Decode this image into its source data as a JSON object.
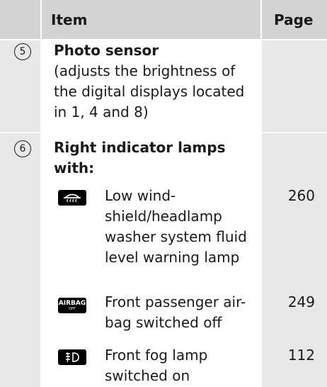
{
  "header": {
    "item_label": "Item",
    "page_label": "Page"
  },
  "rows": [
    {
      "number": "5",
      "title": "Photo sensor",
      "description_lines": [
        "(adjusts the brightness of",
        "the digital displays located",
        "in 1, 4 and 8)"
      ]
    },
    {
      "number": "6",
      "title_lines": [
        "Right indicator lamps",
        "with:"
      ],
      "lamps": [
        {
          "icon": "washer-fluid-icon",
          "text_lines": [
            "Low wind-",
            "shield/headlamp",
            "washer system fluid",
            "level warning lamp"
          ],
          "page": "260"
        },
        {
          "icon": "airbag-off-icon",
          "icon_label": "AIRBAG",
          "icon_sublabel": "OFF",
          "text_lines": [
            "Front passenger air-",
            "bag switched off"
          ],
          "page": "249"
        },
        {
          "icon": "front-fog-lamp-icon",
          "text_lines": [
            "Front fog lamp",
            "switched on"
          ],
          "page": "112"
        }
      ]
    }
  ],
  "colors": {
    "header_bg": "#d3d3d3",
    "side_col_bg": "#e8e8e8",
    "lamp_bg": "#000000"
  }
}
